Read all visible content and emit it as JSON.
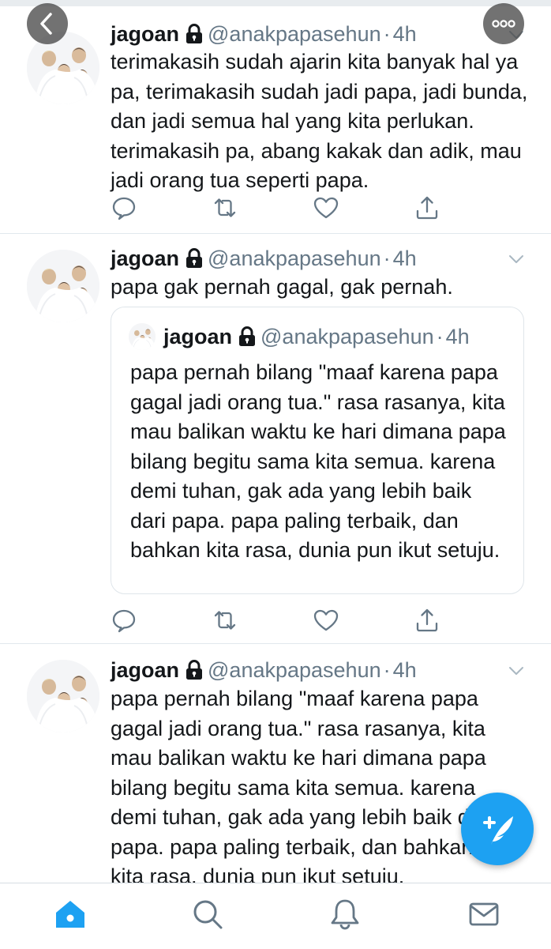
{
  "tweets": [
    {
      "name": "jagoan",
      "handle": "@anakpapasehun",
      "separator": "·",
      "time": "4h",
      "text": "terimakasih sudah ajarin kita banyak hal ya pa, terimakasih sudah jadi papa, jadi bunda, dan jadi semua hal yang kita perlukan. terimakasih pa, abang kakak dan adik, mau jadi orang tua seperti papa."
    },
    {
      "name": "jagoan",
      "handle": "@anakpapasehun",
      "separator": "·",
      "time": "4h",
      "text": "papa gak pernah gagal, gak pernah.",
      "quoted": {
        "name": "jagoan",
        "handle": "@anakpapasehun",
        "separator": "·",
        "time": "4h",
        "text": "papa pernah bilang \"maaf karena papa gagal jadi orang tua.\" rasa rasanya, kita mau balikan waktu ke hari dimana papa bilang begitu sama kita semua. karena demi tuhan, gak ada yang lebih baik dari papa. papa paling terbaik, dan bahkan kita rasa, dunia pun ikut setuju."
      }
    },
    {
      "name": "jagoan",
      "handle": "@anakpapasehun",
      "separator": "·",
      "time": "4h",
      "text": "papa pernah bilang \"maaf karena papa gagal jadi orang tua.\" rasa rasanya, kita mau balikan waktu ke hari dimana papa bilang begitu sama kita semua. karena demi tuhan, gak ada yang lebih baik dari papa. papa paling terbaik, dan bahkan kita rasa, dunia pun ikut setuju."
    }
  ],
  "icons": {
    "lock": "lock-icon",
    "reply": "reply-icon",
    "retweet": "retweet-icon",
    "like": "heart-icon",
    "share": "share-icon",
    "caret": "chevron-down-icon",
    "back": "chevron-left-icon",
    "more": "more-horizontal-icon",
    "compose": "compose-feather-icon",
    "tabs": [
      "home-icon",
      "search-icon",
      "notifications-icon",
      "messages-icon"
    ]
  },
  "colors": {
    "accent": "#1da1f2",
    "text": "#14171a",
    "secondary": "#657786",
    "divider": "#e1e8ed"
  }
}
